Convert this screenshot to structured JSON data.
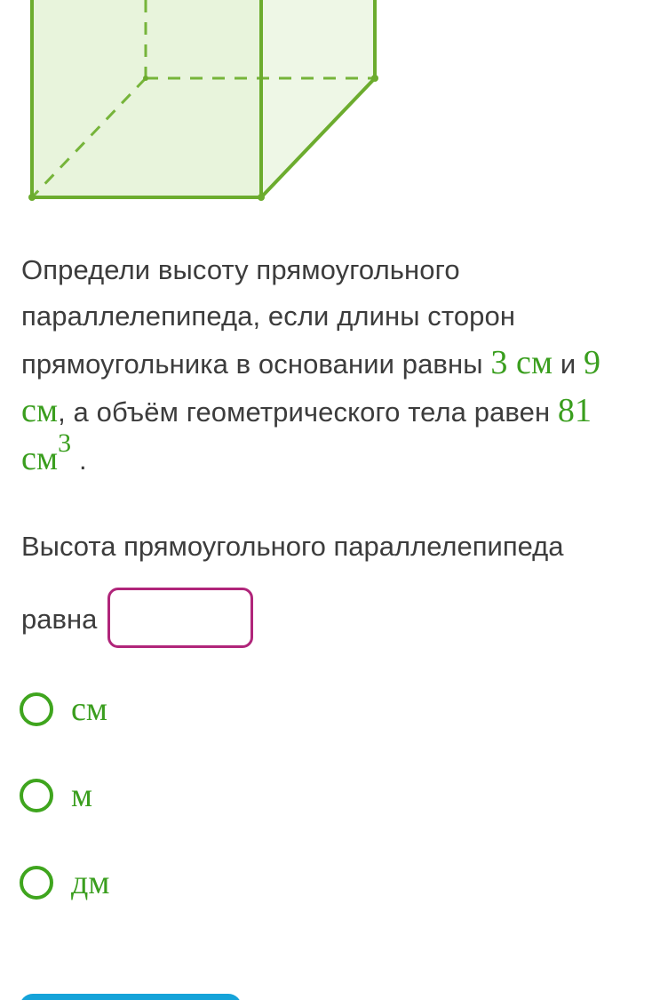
{
  "problem": {
    "text1": "Определи высоту прямоугольного параллелепипеда, если длины сторон прямоугольника в основании равны ",
    "side_a": "3 см",
    "text2": " и ",
    "side_b": "9 см",
    "text3": ", а объём геометрического тела равен ",
    "volume_value": "81 см",
    "volume_exp": "3",
    "text4": " ."
  },
  "question": {
    "line1": "Высота прямоугольного параллелепипеда",
    "line2": "равна",
    "input_value": ""
  },
  "options": [
    {
      "label": "см",
      "selected": false
    },
    {
      "label": "м",
      "selected": false
    },
    {
      "label": "дм",
      "selected": false
    }
  ],
  "colors": {
    "accent_green": "#3a9e1e",
    "input_border": "#b0257a",
    "figure_fill": "#eaf5df",
    "button_blue": "#15a3d9"
  }
}
